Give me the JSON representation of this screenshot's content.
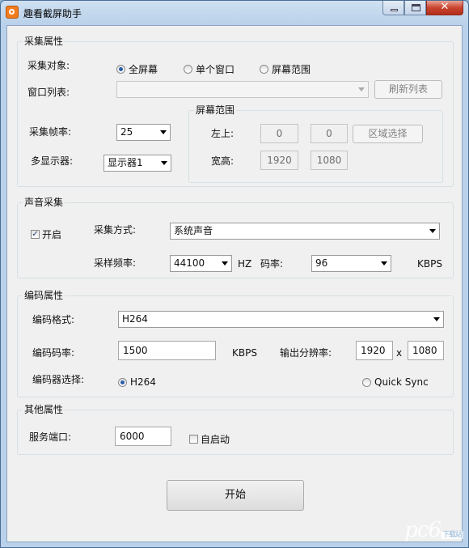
{
  "window": {
    "title": "趣看截屏助手",
    "close_glyph": "✕"
  },
  "capture": {
    "group_title": "采集属性",
    "target_label": "采集对象:",
    "target_options": [
      "全屏幕",
      "单个窗口",
      "屏幕范围"
    ],
    "target_selected": 0,
    "window_list_label": "窗口列表:",
    "window_list_value": "",
    "refresh_button": "刷新列表",
    "fps_label": "采集帧率:",
    "fps_value": "25",
    "display_label": "多显示器:",
    "display_value": "显示器1",
    "range": {
      "group_title": "屏幕范围",
      "top_left_label": "左上:",
      "x": "0",
      "y": "0",
      "select_button": "区域选择",
      "size_label": "宽高:",
      "width": "1920",
      "height": "1080"
    }
  },
  "audio": {
    "group_title": "声音采集",
    "enable_label": "开启",
    "enabled": true,
    "check_glyph": "✓",
    "method_label": "采集方式:",
    "method_value": "系统声音",
    "sample_rate_label": "采样频率:",
    "sample_rate_value": "44100",
    "sample_rate_unit": "HZ",
    "bitrate_label": "码率:",
    "bitrate_value": "96",
    "bitrate_unit": "KBPS"
  },
  "encode": {
    "group_title": "编码属性",
    "format_label": "编码格式:",
    "format_value": "H264",
    "bitrate_label": "编码码率:",
    "bitrate_value": "1500",
    "bitrate_unit": "KBPS",
    "resolution_label": "输出分辨率:",
    "res_width": "1920",
    "res_x": "x",
    "res_height": "1080",
    "encoder_label": "编码器选择:",
    "encoder_options": [
      "H264",
      "Quick Sync"
    ],
    "encoder_selected": 0
  },
  "other": {
    "group_title": "其他属性",
    "port_label": "服务端口:",
    "port_value": "6000",
    "autostart_label": "自启动",
    "autostart": false
  },
  "start_button": "开始",
  "watermark": {
    "text": "pc6",
    "badge": "下载站"
  }
}
